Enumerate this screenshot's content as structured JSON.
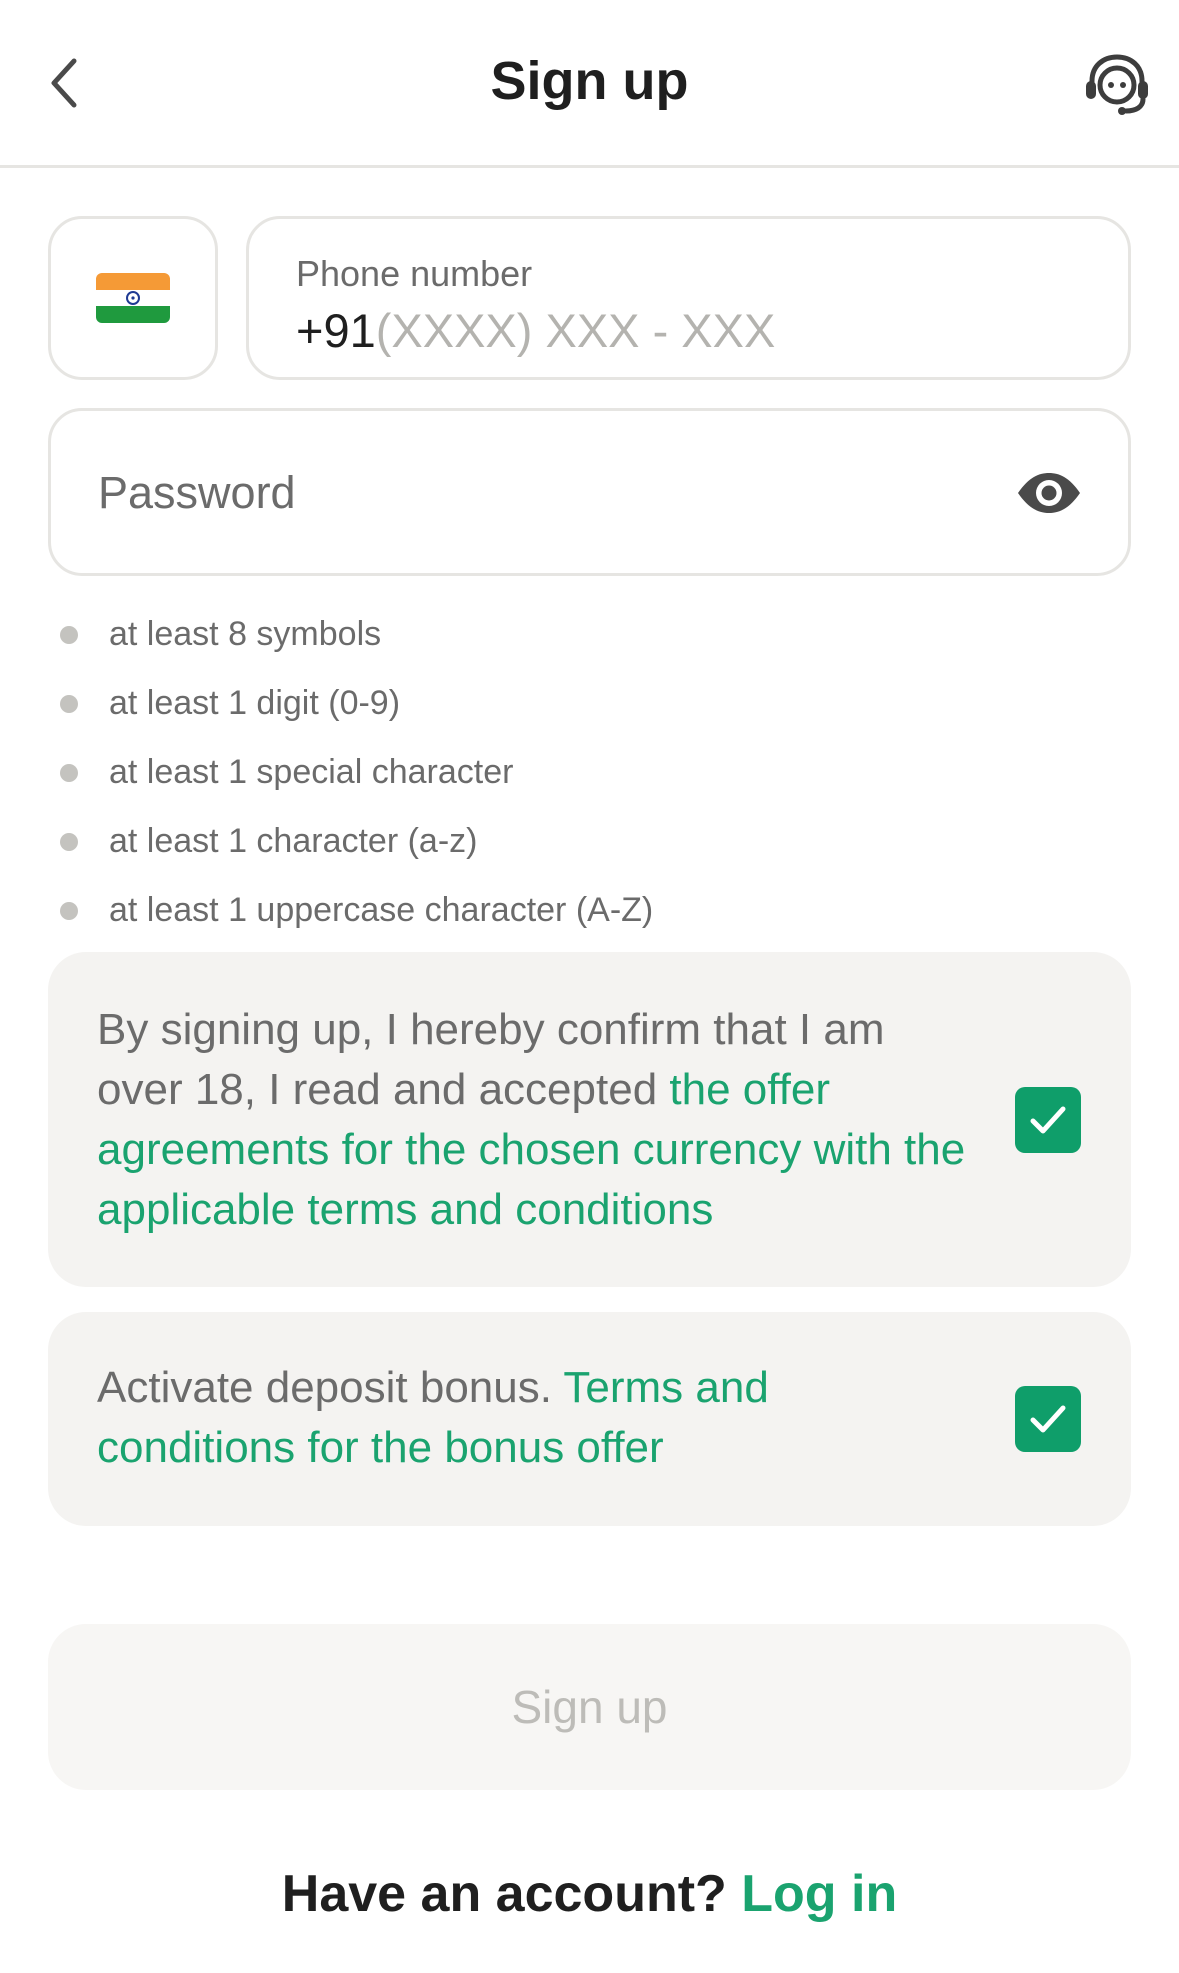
{
  "header": {
    "title": "Sign up",
    "back_icon": "chevron-left-icon",
    "support_icon": "headset-support-icon"
  },
  "phone": {
    "country_flag": "india-flag-icon",
    "label": "Phone number",
    "prefix": "+91",
    "placeholder": "(XXXX) XXX - XXX"
  },
  "password": {
    "placeholder": "Password",
    "visibility_icon": "eye-icon"
  },
  "rules": [
    "at least 8 symbols",
    "at least 1 digit (0-9)",
    "at least 1 special character",
    "at least 1 character (a-z)",
    "at least 1 uppercase character (A-Z)"
  ],
  "consent": {
    "text_prefix": "By signing up, I hereby confirm that I am over 18, I read and accepted ",
    "link_text": "the offer agreements for the chosen currency with the applicable terms and conditions",
    "checked": true
  },
  "bonus": {
    "text_prefix": "Activate deposit bonus. ",
    "link_text": "Terms and conditions for the bonus offer",
    "checked": true
  },
  "submit": {
    "label": "Sign up"
  },
  "footer": {
    "question": "Have an account?",
    "login_label": "Log in"
  },
  "colors": {
    "accent_green": "#1aa36f",
    "checkbox_green": "#0f9e6a",
    "text_dark": "#1f1f1f",
    "text_muted": "#6b6b6b",
    "card_bg": "#f4f3f1"
  }
}
